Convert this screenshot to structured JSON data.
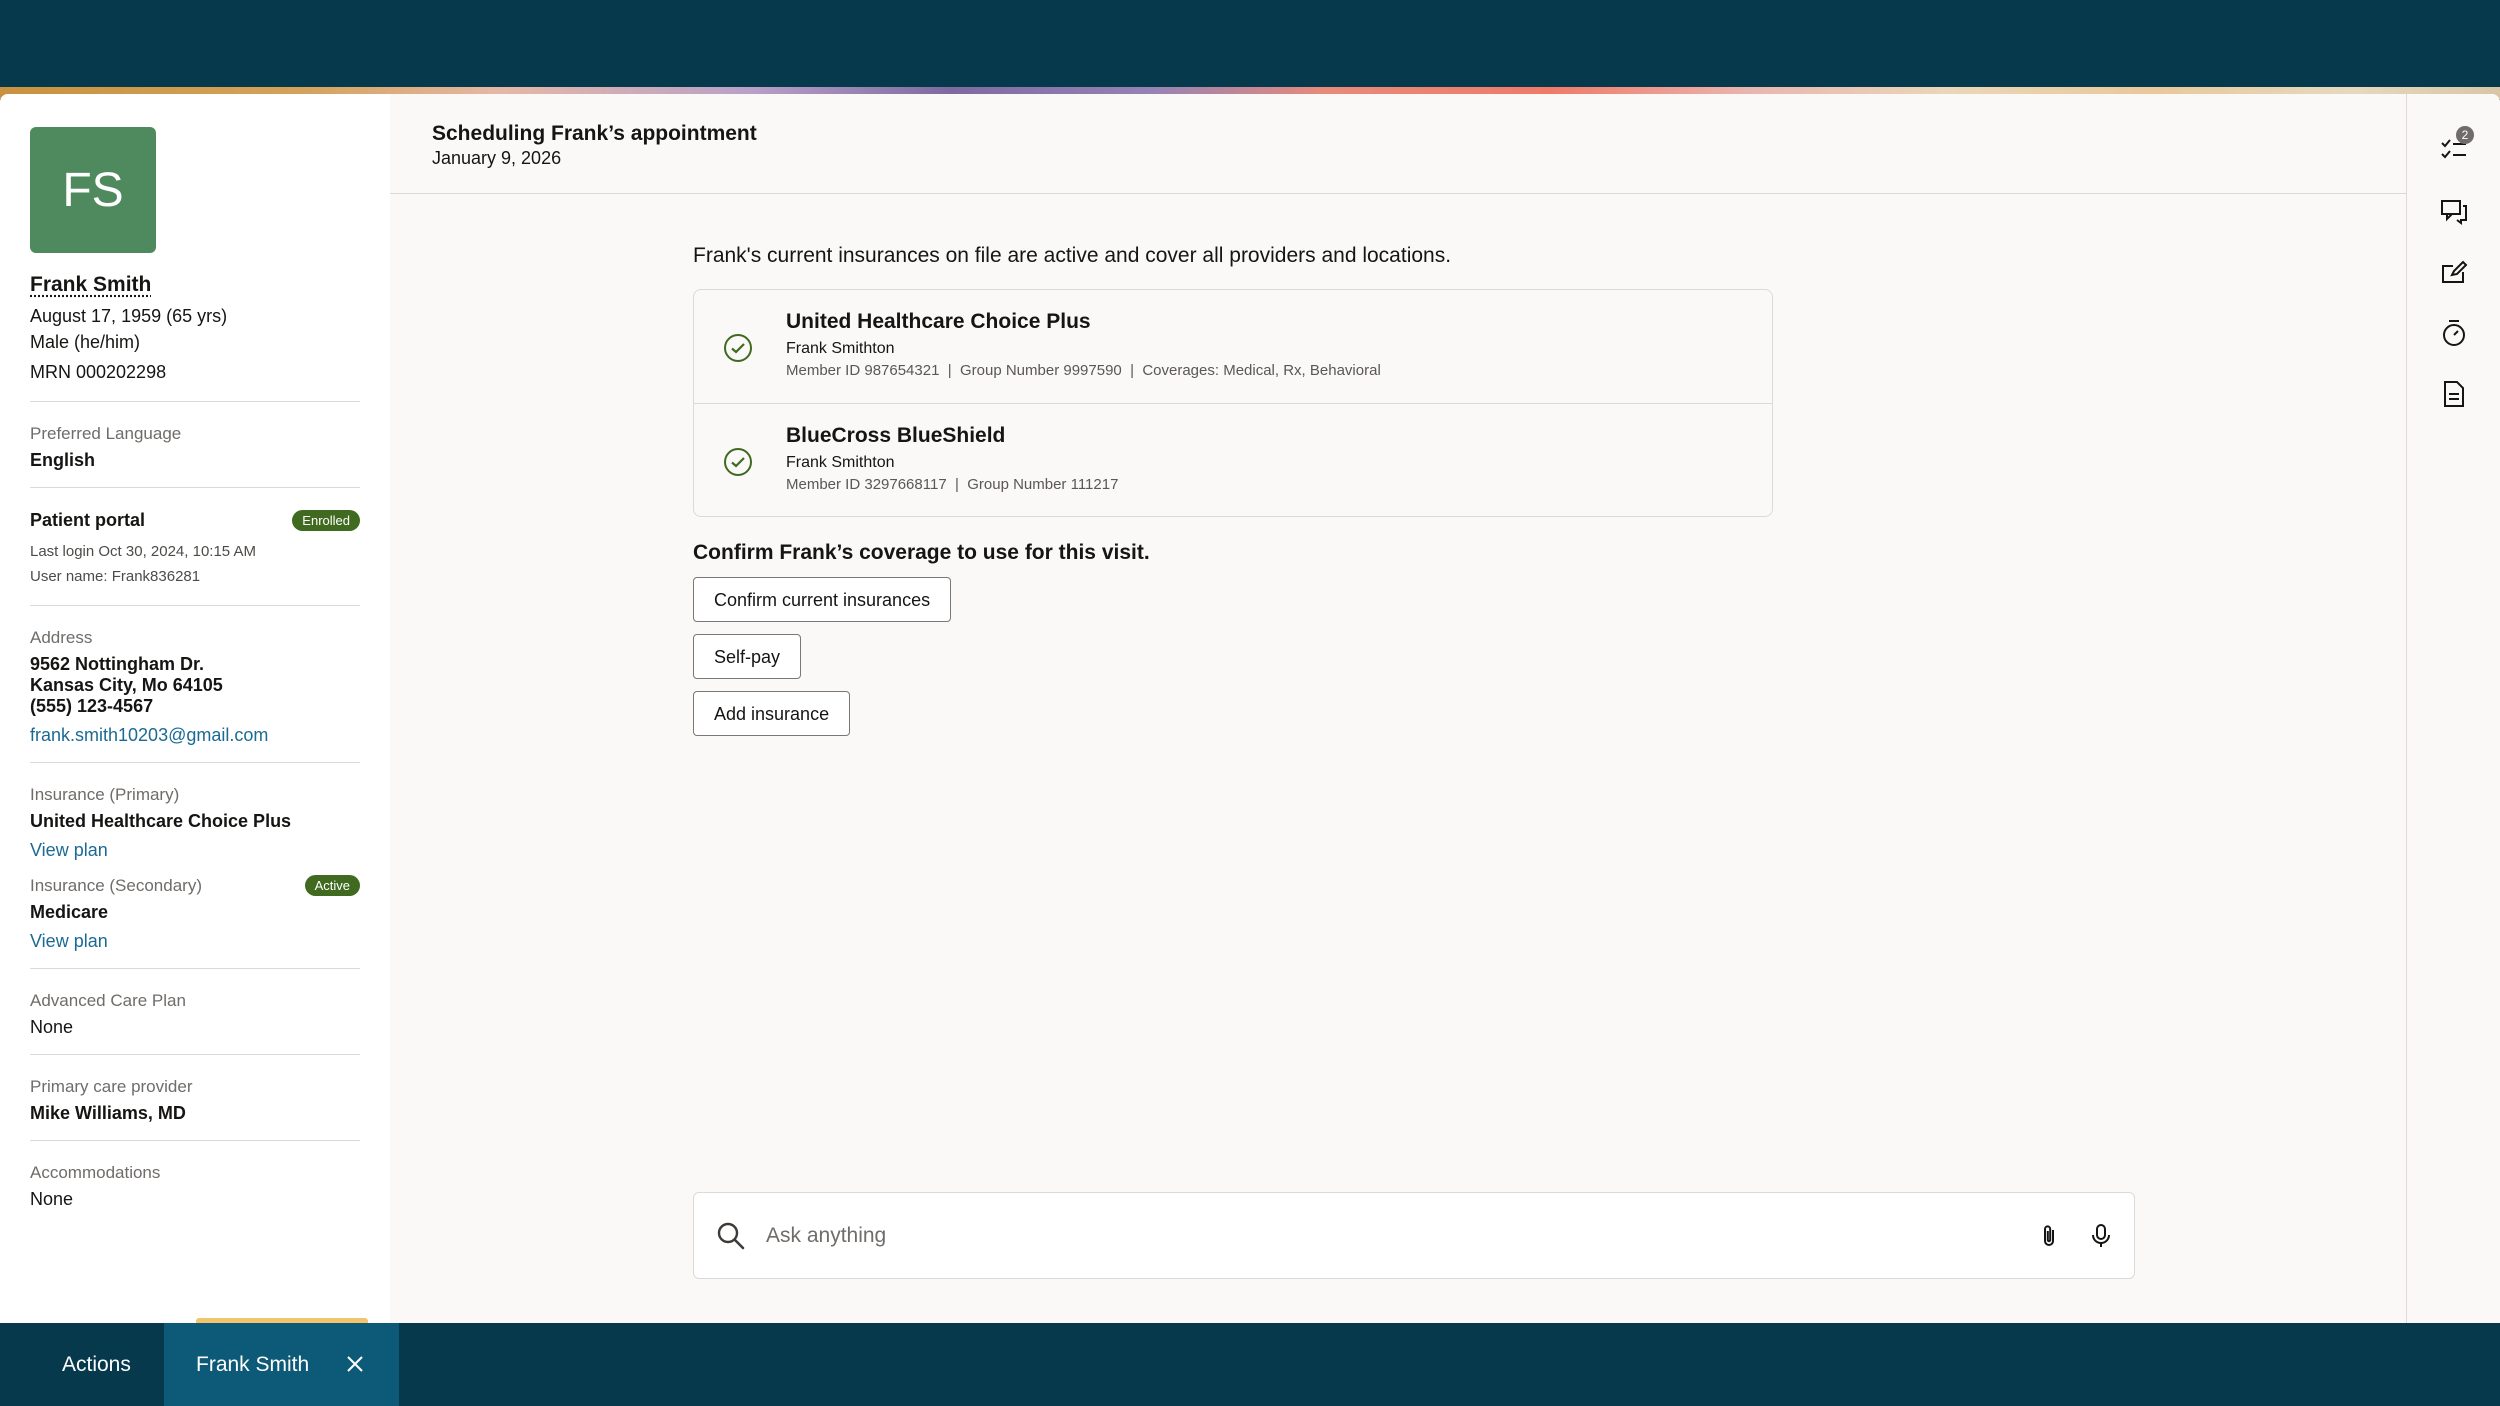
{
  "patient": {
    "initials": "FS",
    "name": "Frank Smith",
    "dob": "August 17, 1959 (65 yrs)",
    "gender": "Male (he/him)",
    "mrn": "MRN 000202298",
    "preferred_language_label": "Preferred Language",
    "preferred_language": "English",
    "portal_label": "Patient portal",
    "portal_status": "Enrolled",
    "last_login": "Last login Oct 30, 2024, 10:15 AM",
    "username": "User name: Frank836281",
    "address_label": "Address",
    "address_line1": "9562 Nottingham Dr.",
    "address_line2": "Kansas City, Mo 64105",
    "phone": "(555) 123-4567",
    "email": "frank.smith10203@gmail.com",
    "ins_primary_label": "Insurance (Primary)",
    "ins_primary": "United Healthcare Choice Plus",
    "ins_primary_link": "View plan",
    "ins_secondary_label": "Insurance (Secondary)",
    "ins_secondary_status": "Active",
    "ins_secondary": "Medicare",
    "ins_secondary_link": "View plan",
    "acp_label": "Advanced Care Plan",
    "acp": "None",
    "pcp_label": "Primary care provider",
    "pcp": "Mike Williams, MD",
    "accommodations_label": "Accommodations",
    "accommodations": "None"
  },
  "header": {
    "title": "Scheduling Frank’s appointment",
    "date": "January 9, 2026"
  },
  "main": {
    "intro": "Frank's current insurances on file are active and cover all providers and locations.",
    "insurances": [
      {
        "name": "United Healthcare Choice Plus",
        "holder": "Frank Smithton",
        "details": "Member ID 987654321  |  Group Number 9997590  |  Coverages: Medical, Rx, Behavioral"
      },
      {
        "name": "BlueCross BlueShield",
        "holder": "Frank Smithton",
        "details": "Member ID 3297668117  |  Group Number 111217"
      }
    ],
    "confirm_question": "Confirm Frank’s coverage to use for this visit.",
    "buttons": [
      "Confirm current insurances",
      "Self-pay",
      "Add insurance"
    ]
  },
  "ask": {
    "placeholder": "Ask anything"
  },
  "rail": {
    "tasks_badge": "2"
  },
  "taskbar": {
    "actions": "Actions",
    "tab": "Frank Smith"
  },
  "colors": {
    "accent_green": "#3f6a1f",
    "avatar": "#4f8a5f",
    "link": "#1b6a93",
    "taskbar": "#07394d",
    "active_tab": "#0d5a78"
  },
  "icons": [
    "search-icon",
    "attachment-icon",
    "microphone-icon",
    "tasks-icon",
    "chat-icon",
    "edit-box-icon",
    "timer-icon",
    "document-icon",
    "close-icon",
    "check-circle-icon"
  ]
}
